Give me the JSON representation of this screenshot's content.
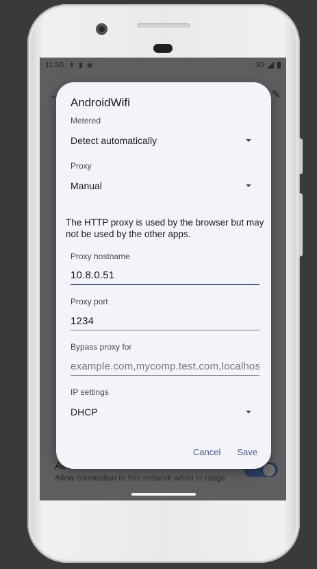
{
  "statusbar": {
    "time": "11:50",
    "network": "3G",
    "icons": [
      "download-icon",
      "sim-icon",
      "vpn-icon"
    ]
  },
  "background": {
    "auto_connect_label": "Auto-connect",
    "auto_connect_desc": "Allow connection to this network when in range",
    "auto_connect_on": true
  },
  "dialog": {
    "title": "AndroidWifi",
    "metered": {
      "label": "Metered",
      "value": "Detect automatically"
    },
    "proxy": {
      "label": "Proxy",
      "value": "Manual"
    },
    "proxy_note": "The HTTP proxy is used by the browser but may not be used by the other apps.",
    "proxy_hostname": {
      "label": "Proxy hostname",
      "value": "10.8.0.51"
    },
    "proxy_port": {
      "label": "Proxy port",
      "value": "1234"
    },
    "bypass": {
      "label": "Bypass proxy for",
      "placeholder": "example.com,mycomp.test.com,localhost"
    },
    "ip_settings": {
      "label": "IP settings",
      "value": "DHCP"
    },
    "cancel_label": "Cancel",
    "save_label": "Save"
  },
  "colors": {
    "accent": "#4a5589",
    "dialog_bg": "#f4f3f9",
    "scrim": "#5e5e60"
  }
}
